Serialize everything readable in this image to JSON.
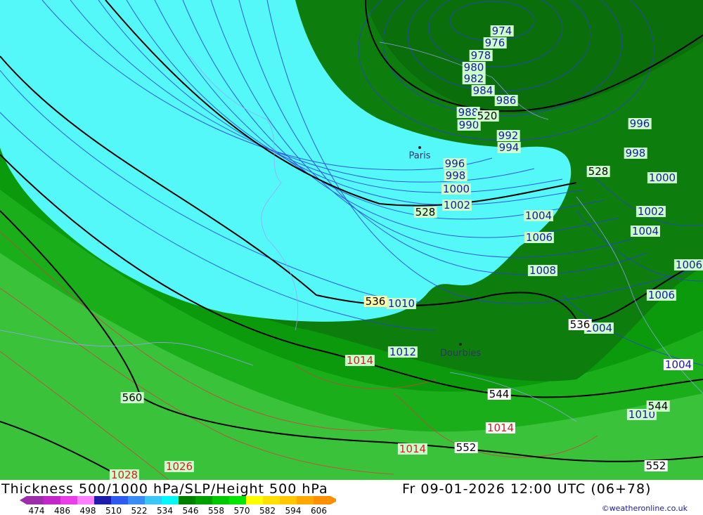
{
  "header": {
    "title": "Thickness 500/1000 hPa/SLP/Height 500 hPa",
    "valid_time": "Fr 09-01-2026 12:00 UTC (06+78)",
    "credit": "©weatheronline.co.uk"
  },
  "cities": {
    "paris": "Paris",
    "dourbies": "Dourbies"
  },
  "slp_labels": [
    "974",
    "976",
    "978",
    "980",
    "982",
    "984",
    "986",
    "988",
    "990",
    "992",
    "994",
    "996",
    "998",
    "1000",
    "1002",
    "1004",
    "1006",
    "1008",
    "1010",
    "1012",
    "1014",
    "1026",
    "1028"
  ],
  "thickness_labels": [
    "520",
    "528",
    "536",
    "544",
    "552",
    "560"
  ],
  "legend": {
    "ticks": [
      "474",
      "486",
      "498",
      "510",
      "522",
      "534",
      "546",
      "558",
      "570",
      "582",
      "594",
      "606"
    ],
    "colors": [
      "#9c2ea9",
      "#c026c9",
      "#e83de8",
      "#ff80ff",
      "#1c1ca8",
      "#2f5cf0",
      "#3a8cf5",
      "#3cc6f6",
      "#00fafa",
      "#008000",
      "#00a000",
      "#00c800",
      "#00e600",
      "#ffff00",
      "#ffe000",
      "#ffc800",
      "#ffa800",
      "#ff9000"
    ]
  },
  "colors": {
    "cyan_zone": "#55f8f8",
    "dark_green": "#0d7e0d",
    "mid_green": "#0b9a0b",
    "green": "#18b018",
    "light_green": "#3bc23b"
  }
}
